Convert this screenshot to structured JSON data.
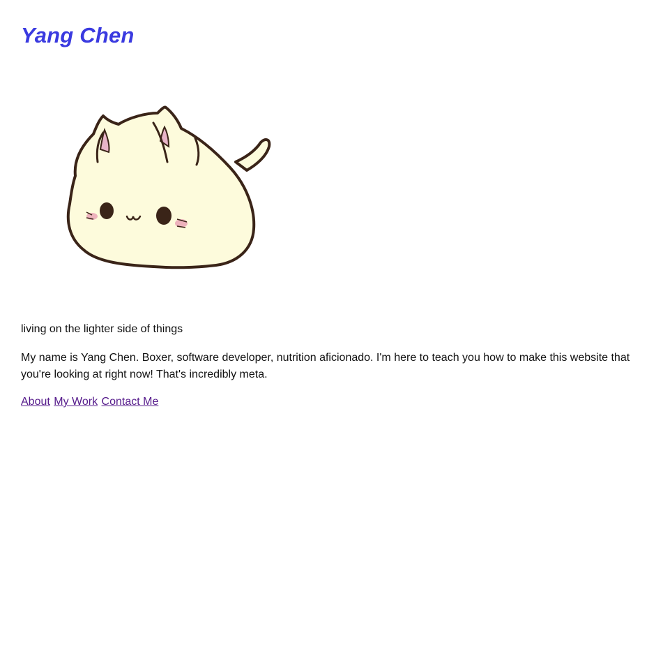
{
  "site": {
    "title": "Yang Chen",
    "title_color": "#3a3ae0"
  },
  "hero": {
    "image_icon": "cat-bun-icon",
    "body_fill": "#fdfbdc",
    "outline_color": "#3a2418",
    "ear_pink": "#e8b4c8",
    "blush_pink": "#e8a0b4"
  },
  "tagline": "living on the lighter side of things",
  "bio": "My name is Yang Chen. Boxer, software developer, nutrition aficionado. I'm here to teach you how to make this website that you're looking at right now! That's incredibly meta.",
  "nav": {
    "link_color": "#551a8b",
    "items": [
      {
        "label": "About"
      },
      {
        "label": "My Work"
      },
      {
        "label": "Contact Me"
      }
    ]
  }
}
